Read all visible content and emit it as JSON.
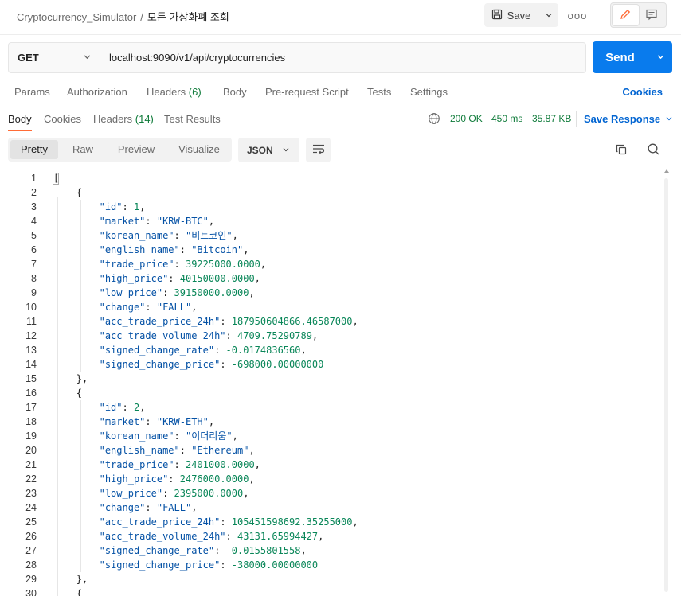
{
  "header": {
    "collection": "Cryptocurrency_Simulator",
    "separator": "/",
    "request_name": "모든 가상화폐 조회",
    "save_label": "Save",
    "more_label": "ooo"
  },
  "request": {
    "method": "GET",
    "url": "localhost:9090/v1/api/cryptocurrencies",
    "send_label": "Send"
  },
  "request_tabs": [
    {
      "label": "Params",
      "count": ""
    },
    {
      "label": "Authorization",
      "count": ""
    },
    {
      "label": "Headers",
      "count": "(6)"
    },
    {
      "label": "Body",
      "count": ""
    },
    {
      "label": "Pre-request Script",
      "count": ""
    },
    {
      "label": "Tests",
      "count": ""
    },
    {
      "label": "Settings",
      "count": ""
    }
  ],
  "cookies_link": "Cookies",
  "response_tabs": [
    {
      "label": "Body",
      "count": ""
    },
    {
      "label": "Cookies",
      "count": ""
    },
    {
      "label": "Headers",
      "count": "(14)"
    },
    {
      "label": "Test Results",
      "count": ""
    }
  ],
  "response_status": {
    "status": "200 OK",
    "time": "450 ms",
    "size": "35.87 KB",
    "save_response": "Save Response"
  },
  "view_modes": [
    "Pretty",
    "Raw",
    "Preview",
    "Visualize"
  ],
  "active_view": "Pretty",
  "format": "JSON",
  "colors": {
    "accent_orange": "#ff6c37",
    "send_blue": "#097bed",
    "link_blue": "#0265d2",
    "status_green": "#0f7b3a",
    "json_key": "#0451a5",
    "json_number": "#098658"
  },
  "body_lines": [
    {
      "n": "1",
      "indent": 0,
      "t": "p",
      "text": "["
    },
    {
      "n": "2",
      "indent": 1,
      "t": "p",
      "text": "{"
    },
    {
      "n": "3",
      "indent": 2,
      "t": "kv",
      "key": "id",
      "vtype": "n",
      "value": "1",
      "comma": ","
    },
    {
      "n": "4",
      "indent": 2,
      "t": "kv",
      "key": "market",
      "vtype": "s",
      "value": "KRW-BTC",
      "comma": ","
    },
    {
      "n": "5",
      "indent": 2,
      "t": "kv",
      "key": "korean_name",
      "vtype": "s",
      "value": "비트코인",
      "comma": ","
    },
    {
      "n": "6",
      "indent": 2,
      "t": "kv",
      "key": "english_name",
      "vtype": "s",
      "value": "Bitcoin",
      "comma": ","
    },
    {
      "n": "7",
      "indent": 2,
      "t": "kv",
      "key": "trade_price",
      "vtype": "n",
      "value": "39225000.0000",
      "comma": ","
    },
    {
      "n": "8",
      "indent": 2,
      "t": "kv",
      "key": "high_price",
      "vtype": "n",
      "value": "40150000.0000",
      "comma": ","
    },
    {
      "n": "9",
      "indent": 2,
      "t": "kv",
      "key": "low_price",
      "vtype": "n",
      "value": "39150000.0000",
      "comma": ","
    },
    {
      "n": "10",
      "indent": 2,
      "t": "kv",
      "key": "change",
      "vtype": "s",
      "value": "FALL",
      "comma": ","
    },
    {
      "n": "11",
      "indent": 2,
      "t": "kv",
      "key": "acc_trade_price_24h",
      "vtype": "n",
      "value": "187950604866.46587000",
      "comma": ","
    },
    {
      "n": "12",
      "indent": 2,
      "t": "kv",
      "key": "acc_trade_volume_24h",
      "vtype": "n",
      "value": "4709.75290789",
      "comma": ","
    },
    {
      "n": "13",
      "indent": 2,
      "t": "kv",
      "key": "signed_change_rate",
      "vtype": "n",
      "value": "-0.0174836560",
      "comma": ","
    },
    {
      "n": "14",
      "indent": 2,
      "t": "kv",
      "key": "signed_change_price",
      "vtype": "n",
      "value": "-698000.00000000",
      "comma": ""
    },
    {
      "n": "15",
      "indent": 1,
      "t": "p",
      "text": "},"
    },
    {
      "n": "16",
      "indent": 1,
      "t": "p",
      "text": "{"
    },
    {
      "n": "17",
      "indent": 2,
      "t": "kv",
      "key": "id",
      "vtype": "n",
      "value": "2",
      "comma": ","
    },
    {
      "n": "18",
      "indent": 2,
      "t": "kv",
      "key": "market",
      "vtype": "s",
      "value": "KRW-ETH",
      "comma": ","
    },
    {
      "n": "19",
      "indent": 2,
      "t": "kv",
      "key": "korean_name",
      "vtype": "s",
      "value": "이더리움",
      "comma": ","
    },
    {
      "n": "20",
      "indent": 2,
      "t": "kv",
      "key": "english_name",
      "vtype": "s",
      "value": "Ethereum",
      "comma": ","
    },
    {
      "n": "21",
      "indent": 2,
      "t": "kv",
      "key": "trade_price",
      "vtype": "n",
      "value": "2401000.0000",
      "comma": ","
    },
    {
      "n": "22",
      "indent": 2,
      "t": "kv",
      "key": "high_price",
      "vtype": "n",
      "value": "2476000.0000",
      "comma": ","
    },
    {
      "n": "23",
      "indent": 2,
      "t": "kv",
      "key": "low_price",
      "vtype": "n",
      "value": "2395000.0000",
      "comma": ","
    },
    {
      "n": "24",
      "indent": 2,
      "t": "kv",
      "key": "change",
      "vtype": "s",
      "value": "FALL",
      "comma": ","
    },
    {
      "n": "25",
      "indent": 2,
      "t": "kv",
      "key": "acc_trade_price_24h",
      "vtype": "n",
      "value": "105451598692.35255000",
      "comma": ","
    },
    {
      "n": "26",
      "indent": 2,
      "t": "kv",
      "key": "acc_trade_volume_24h",
      "vtype": "n",
      "value": "43131.65994427",
      "comma": ","
    },
    {
      "n": "27",
      "indent": 2,
      "t": "kv",
      "key": "signed_change_rate",
      "vtype": "n",
      "value": "-0.0155801558",
      "comma": ","
    },
    {
      "n": "28",
      "indent": 2,
      "t": "kv",
      "key": "signed_change_price",
      "vtype": "n",
      "value": "-38000.00000000",
      "comma": ""
    },
    {
      "n": "29",
      "indent": 1,
      "t": "p",
      "text": "},"
    },
    {
      "n": "30",
      "indent": 1,
      "t": "p",
      "text": "{"
    }
  ]
}
